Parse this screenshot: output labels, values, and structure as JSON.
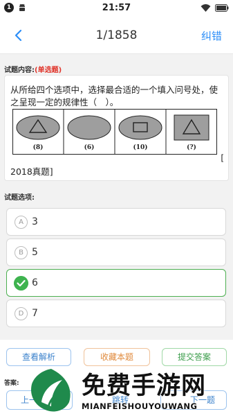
{
  "status_bar": {
    "badge": "1",
    "time": "21:57"
  },
  "nav": {
    "title": "1/1858",
    "right_label": "纠错"
  },
  "question": {
    "section_label": "试题内容:",
    "type_tag": "(单选题)",
    "text": "从所给四个选项中，选择最合适的一个填入问号处，使之呈现一定的规律性（　）。",
    "figure_labels": [
      "(8)",
      "(6)",
      "(10)",
      "(?)"
    ],
    "trailing_bracket": "[",
    "year_text": "2018真题]"
  },
  "options_section": {
    "label": "试题选项:",
    "items": [
      {
        "letter": "A",
        "text": "3",
        "correct": false
      },
      {
        "letter": "B",
        "text": "5",
        "correct": false
      },
      {
        "letter": "C",
        "text": "6",
        "correct": true
      },
      {
        "letter": "D",
        "text": "7",
        "correct": false
      }
    ]
  },
  "actions": {
    "analysis": "查看解析",
    "favorite": "收藏本题",
    "submit": "提交答案"
  },
  "answer_label": "答案:",
  "bottom_nav": {
    "prev": "上一题",
    "jump": "跳转",
    "next": "下一题"
  },
  "watermark": {
    "main": "免费手游网",
    "sub": "MIANFEISHOUYOUWANG"
  },
  "colors": {
    "accent": "#2c8ef8",
    "correct": "#3eb34f",
    "type_tag": "#e0342a"
  }
}
